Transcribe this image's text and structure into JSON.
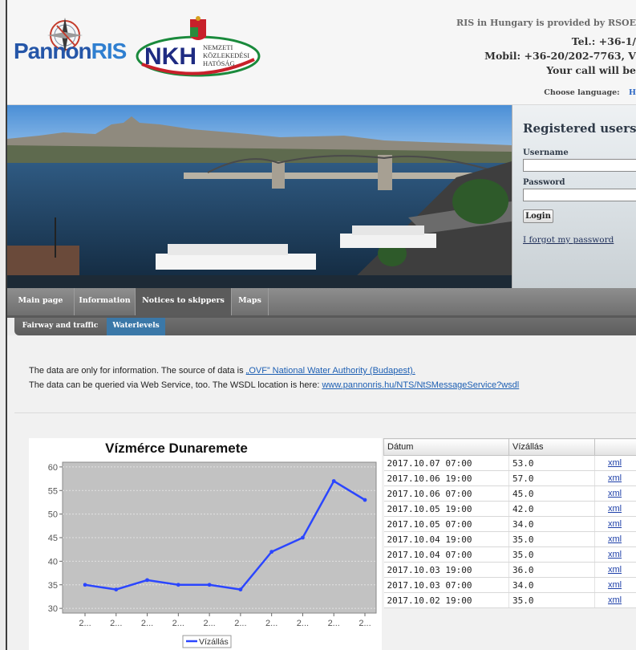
{
  "header": {
    "logo_pannon_a": "Pannon",
    "logo_pannon_b": "RIS",
    "logo_nkh": "NKH",
    "nkh_line1": "NEMZETI",
    "nkh_line2": "KÖZLEKEDÉSI",
    "nkh_line3": "HATÓSÁG",
    "provided_by": "RIS in Hungary is provided by RSOE",
    "tel": "Tel.: +36-1/",
    "mobil": "Mobil: +36-20/202-7763, V",
    "call": "Your call will be",
    "choose_language": "Choose language:",
    "language_option": "H"
  },
  "login": {
    "title": "Registered users:",
    "username_label": "Username",
    "password_label": "Password",
    "login_button": "Login",
    "forgot_link": "I forgot my password"
  },
  "nav": {
    "tabs": [
      "Main page",
      "Information",
      "Notices to skippers",
      "Maps"
    ],
    "active_tab": "Notices to skippers",
    "subtabs": [
      "Fairway and traffic",
      "Waterlevels"
    ],
    "active_subtab": "Waterlevels"
  },
  "info": {
    "line1_prefix": "The data are only for information. The source of data is ",
    "line1_link": "„OVF” National Water Authority (Budapest).",
    "line2_prefix": "The data can be queried via Web Service, too. The WSDL location is here: ",
    "line2_link": "www.pannonris.hu/NTS/NtSMessageService?wsdl"
  },
  "table": {
    "headers": [
      "Dátum",
      "Vízállás",
      ""
    ],
    "rows": [
      [
        "2017.10.07 07:00",
        "53.0",
        "xml"
      ],
      [
        "2017.10.06 19:00",
        "57.0",
        "xml"
      ],
      [
        "2017.10.06 07:00",
        "45.0",
        "xml"
      ],
      [
        "2017.10.05 19:00",
        "42.0",
        "xml"
      ],
      [
        "2017.10.05 07:00",
        "34.0",
        "xml"
      ],
      [
        "2017.10.04 19:00",
        "35.0",
        "xml"
      ],
      [
        "2017.10.04 07:00",
        "35.0",
        "xml"
      ],
      [
        "2017.10.03 19:00",
        "36.0",
        "xml"
      ],
      [
        "2017.10.03 07:00",
        "34.0",
        "xml"
      ],
      [
        "2017.10.02 19:00",
        "35.0",
        "xml"
      ]
    ]
  },
  "chart_data": {
    "type": "line",
    "title": "Vízmérce Dunaremete",
    "xlabel": "",
    "ylabel": "",
    "ylim": [
      29,
      61
    ],
    "yticks": [
      30,
      35,
      40,
      45,
      50,
      55,
      60
    ],
    "x_tick_labels": [
      "2...",
      "2...",
      "2...",
      "2...",
      "2...",
      "2...",
      "2...",
      "2...",
      "2...",
      "2..."
    ],
    "categories": [
      "2017.10.02 19:00",
      "2017.10.03 07:00",
      "2017.10.03 19:00",
      "2017.10.04 07:00",
      "2017.10.04 19:00",
      "2017.10.05 07:00",
      "2017.10.05 19:00",
      "2017.10.06 07:00",
      "2017.10.06 19:00",
      "2017.10.07 07:00"
    ],
    "series": [
      {
        "name": "Vízállás",
        "values": [
          35,
          34,
          36,
          35,
          35,
          34,
          42,
          45,
          57,
          53
        ]
      }
    ],
    "grid": true,
    "legend": "bottom-center",
    "colors": {
      "line": "#2b46ff",
      "plot_bg": "#c2c2c2",
      "grid": "#e2e2e2"
    }
  },
  "colors": {
    "nav_bg": "#7d7d7d",
    "subnav_active": "#3b78a8",
    "link": "#1d5fb3"
  }
}
